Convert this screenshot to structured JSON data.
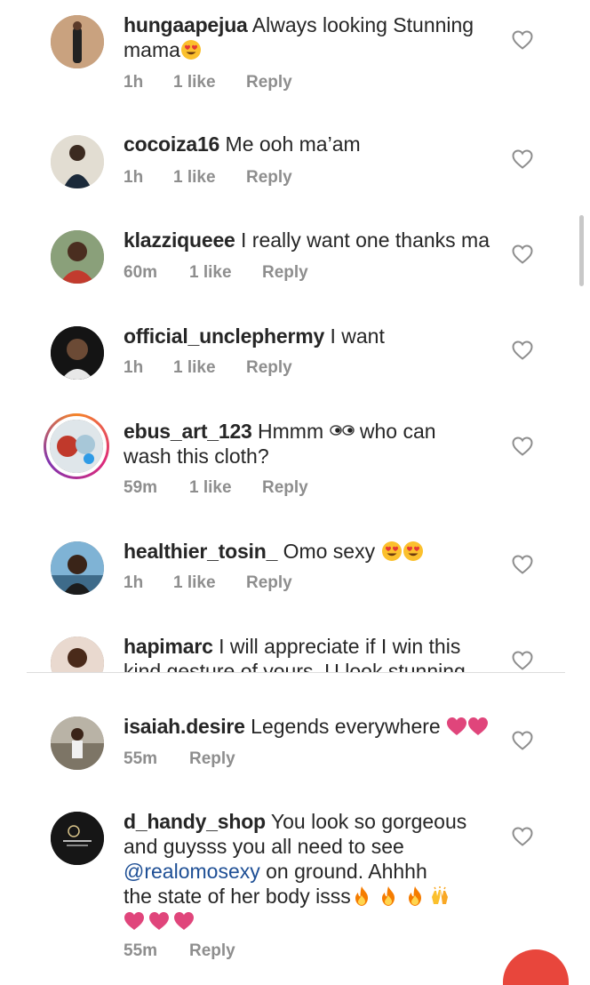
{
  "comments": [
    {
      "username": "hungaapejua",
      "text": "Always looking Stunning",
      "text2": "mama",
      "time": "1h",
      "likes": "1 like",
      "reply": "Reply"
    },
    {
      "username": "cocoiza16",
      "text": "Me ooh ma’am",
      "time": "1h",
      "likes": "1 like",
      "reply": "Reply"
    },
    {
      "username": "klazziqueee",
      "text": "I really want one thanks ma",
      "time": "60m",
      "likes": "1 like",
      "reply": "Reply"
    },
    {
      "username": "official_unclephermy",
      "text": "I want",
      "time": "1h",
      "likes": "1 like",
      "reply": "Reply"
    },
    {
      "username": "ebus_art_123",
      "text": "Hmmm",
      "text_b": "who can",
      "text2": "wash this cloth?",
      "time": "59m",
      "likes": "1 like",
      "reply": "Reply"
    },
    {
      "username": "healthier_tosin_",
      "text": "Omo sexy",
      "time": "1h",
      "likes": "1 like",
      "reply": "Reply"
    },
    {
      "username": "hapimarc",
      "text": "I will appreciate if I win this",
      "text2": "kind gesture of yours. U look stunning"
    },
    {
      "username": "isaiah.desire",
      "text": "Legends everywhere",
      "time": "55m",
      "reply": "Reply"
    },
    {
      "username": "d_handy_shop",
      "text": "You look so gorgeous",
      "text2": "and guysss you all need to see",
      "mention": "@realomosexy",
      "text3": "on ground. Ahhhh",
      "text4": "the state of her body isss",
      "time": "55m",
      "reply": "Reply"
    }
  ],
  "icons": {
    "like": "heart-outline-icon",
    "emoji_love": "heart-eyes-emoji",
    "emoji_eyes": "eyes-emoji",
    "emoji_heart": "pink-heart-emoji",
    "emoji_fire": "fire-emoji",
    "emoji_hands": "raised-hands-emoji"
  },
  "colors": {
    "text": "#262626",
    "meta": "#8e8e8e",
    "mention": "#1e4f95",
    "heart": "#e0457b",
    "fab": "#e8463c"
  }
}
